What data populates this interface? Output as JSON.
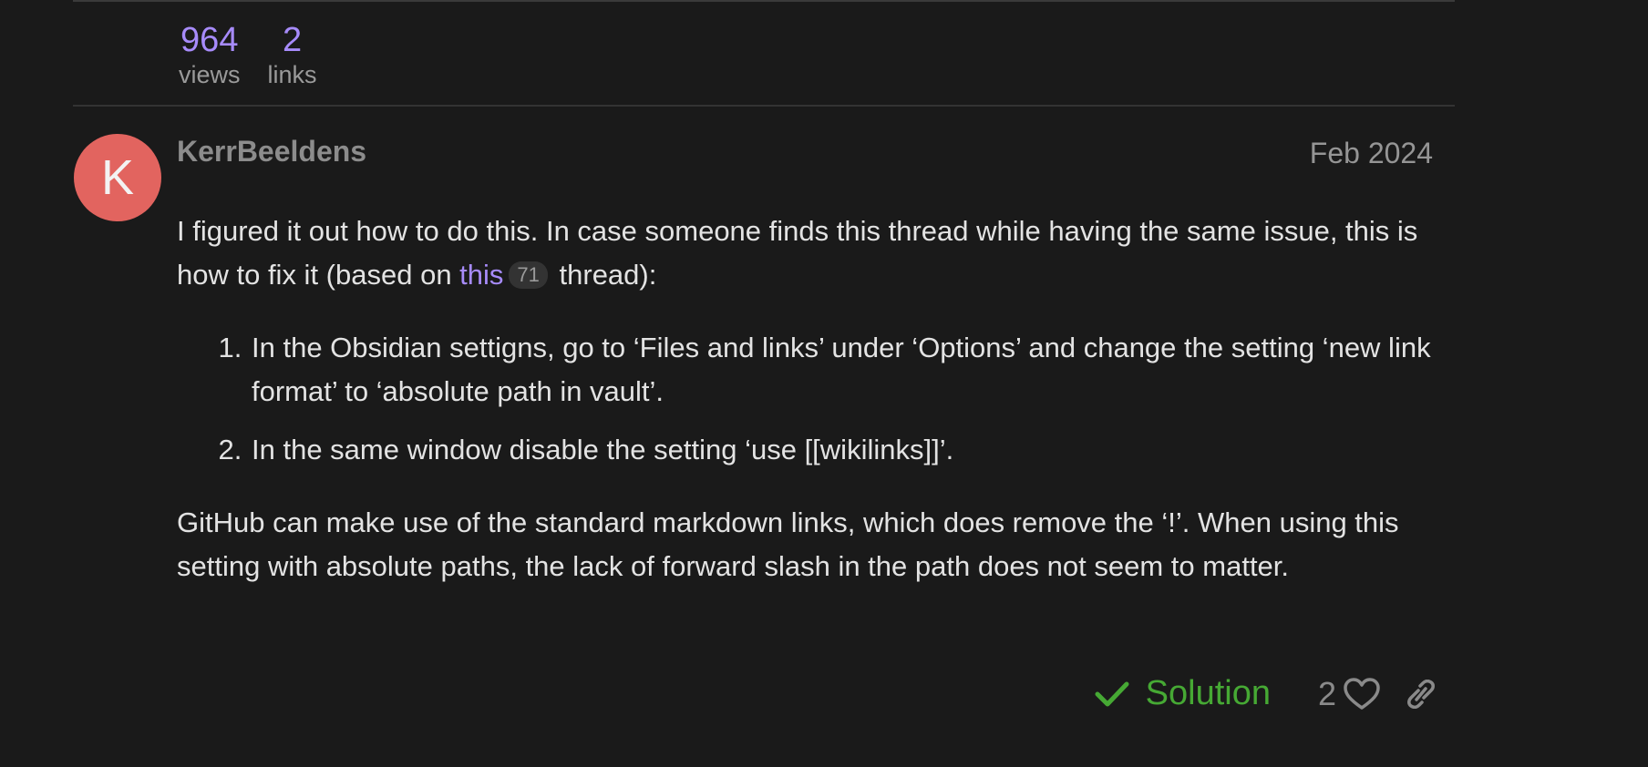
{
  "topic_stats": {
    "views": {
      "count": "964",
      "label": "views"
    },
    "links": {
      "count": "2",
      "label": "links"
    }
  },
  "post": {
    "avatar_letter": "K",
    "avatar_color": "#e2645f",
    "username": "KerrBeeldens",
    "date": "Feb 2024",
    "intro_before_link": "I figured it out how to do this. In case someone finds this thread while having the same issue, this is how to fix it (based on ",
    "link_text": "this",
    "link_click_count": "71",
    "intro_after_link": " thread):",
    "steps": [
      "In the Obsidian settigns, go to ‘Files and links’ under ‘Options’ and change the setting ‘new link format’ to ‘absolute path in vault’.",
      "In the same window disable the setting ‘use [[wikilinks]]’."
    ],
    "outro": "GitHub can make use of the standard markdown links, which does remove the ‘!’. When using this setting with absolute paths, the lack of forward slash in the path does not seem to matter."
  },
  "actions": {
    "solution_label": "Solution",
    "like_count": "2"
  },
  "icons": {
    "solution": "check-icon",
    "like": "heart-icon",
    "share": "link-icon"
  },
  "colors": {
    "accent_link": "#a78bfa",
    "solution_green": "#46a934",
    "background": "#1a1a1a"
  }
}
